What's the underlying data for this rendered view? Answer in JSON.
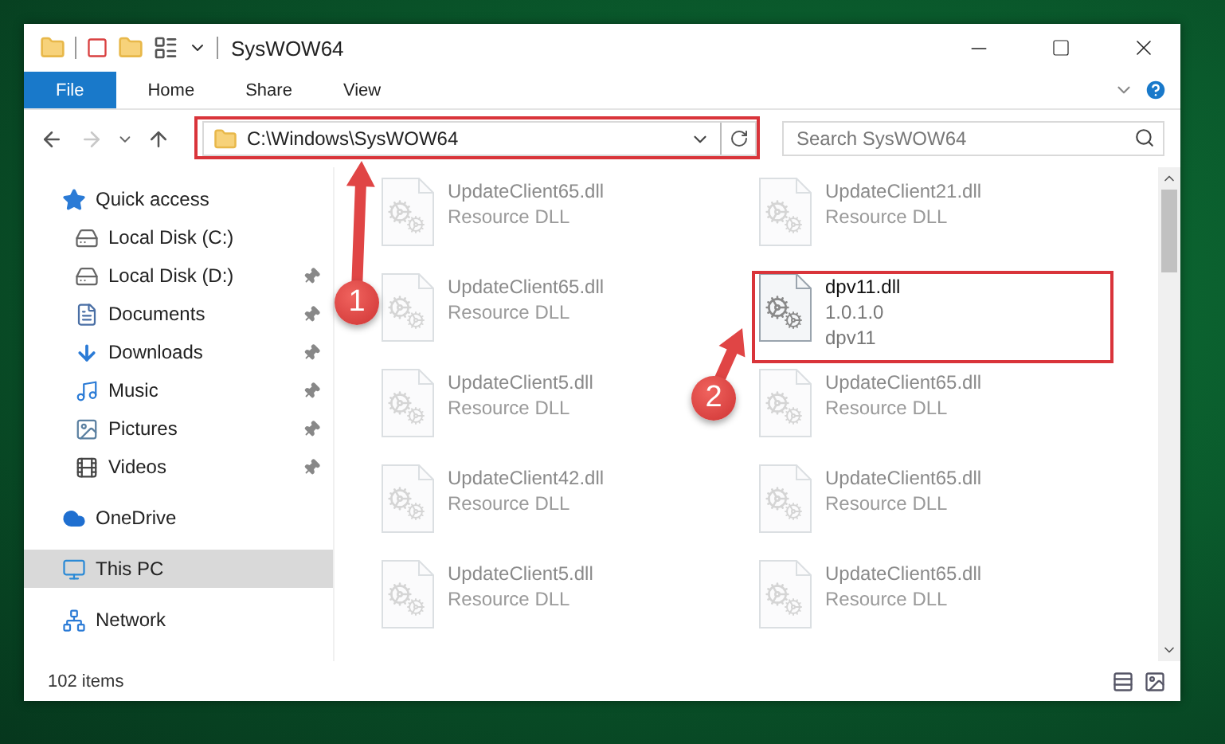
{
  "window": {
    "title": "SysWOW64"
  },
  "ribbon": {
    "tabs": [
      {
        "label": "File",
        "kind": "menu"
      },
      {
        "label": "Home",
        "kind": "tab"
      },
      {
        "label": "Share",
        "kind": "tab"
      },
      {
        "label": "View",
        "kind": "tab"
      }
    ]
  },
  "navigation": {
    "back": {
      "disabled": false
    },
    "forward": {
      "disabled": true
    }
  },
  "address_bar": {
    "path": "C:\\Windows\\SysWOW64"
  },
  "search": {
    "placeholder": "Search SysWOW64"
  },
  "sidebar": {
    "items": [
      {
        "label": "Quick access",
        "kind": "star",
        "selected": false,
        "children": [
          {
            "label": "Local Disk (C:)",
            "kind": "drive",
            "pinned": false
          },
          {
            "label": "Local Disk (D:)",
            "kind": "drive",
            "pinned": true
          },
          {
            "label": "Documents",
            "kind": "document",
            "pinned": true
          },
          {
            "label": "Downloads",
            "kind": "download",
            "pinned": true
          },
          {
            "label": "Music",
            "kind": "music",
            "pinned": true
          },
          {
            "label": "Pictures",
            "kind": "pictures",
            "pinned": true
          },
          {
            "label": "Videos",
            "kind": "videos",
            "pinned": true
          }
        ]
      },
      {
        "label": "OneDrive",
        "kind": "cloud",
        "selected": false
      },
      {
        "label": "This PC",
        "kind": "computer",
        "selected": true
      },
      {
        "label": "Network",
        "kind": "network",
        "selected": false
      }
    ]
  },
  "files": [
    {
      "name": "UpdateClient65.dll",
      "details": [
        "Resource DLL"
      ],
      "kind": "faded"
    },
    {
      "name": "UpdateClient21.dll",
      "details": [
        "Resource DLL"
      ],
      "kind": "faded"
    },
    {
      "name": "UpdateClient65.dll",
      "details": [
        "Resource DLL"
      ],
      "kind": "faded"
    },
    {
      "name": "dpv11.dll",
      "details": [
        "1.0.1.0",
        "dpv11"
      ],
      "kind": "highlighted"
    },
    {
      "name": "UpdateClient5.dll",
      "details": [
        "Resource DLL"
      ],
      "kind": "faded"
    },
    {
      "name": "UpdateClient65.dll",
      "details": [
        "Resource DLL"
      ],
      "kind": "faded"
    },
    {
      "name": "UpdateClient42.dll",
      "details": [
        "Resource DLL"
      ],
      "kind": "faded"
    },
    {
      "name": "UpdateClient65.dll",
      "details": [
        "Resource DLL"
      ],
      "kind": "faded"
    },
    {
      "name": "UpdateClient5.dll",
      "details": [
        "Resource DLL"
      ],
      "kind": "faded"
    },
    {
      "name": "UpdateClient65.dll",
      "details": [
        "Resource DLL"
      ],
      "kind": "faded"
    }
  ],
  "status_bar": {
    "item_count": "102 items"
  },
  "annotations": [
    {
      "label": "1"
    },
    {
      "label": "2"
    }
  ]
}
